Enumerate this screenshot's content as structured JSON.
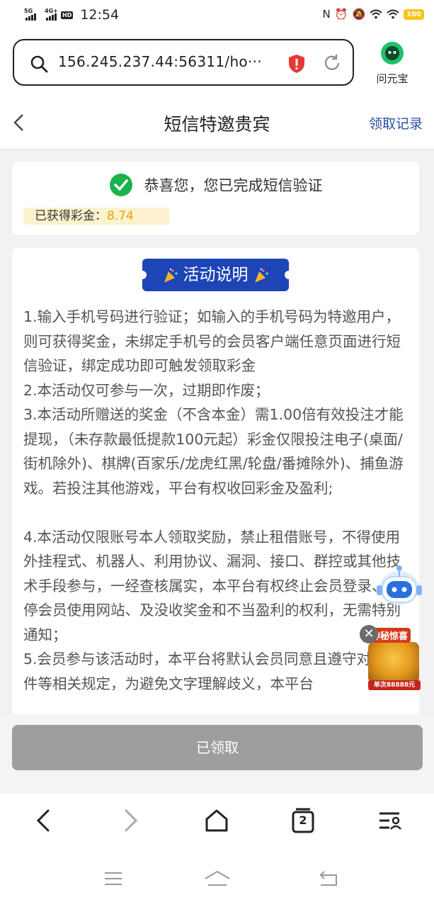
{
  "status_bar": {
    "network_1": "5G",
    "network_2": "4G+",
    "hd_badge": "HD",
    "time": "12:54",
    "battery": "100"
  },
  "browser": {
    "url": "156.245.237.44:56311/ho···",
    "assistant_label": "问元宝"
  },
  "header": {
    "title": "短信特邀贵宾",
    "records_link": "领取记录"
  },
  "verification": {
    "message": "恭喜您，您已完成短信验证",
    "bonus_label": "已获得彩金：",
    "bonus_value": "8.74"
  },
  "activity": {
    "banner_title": "活动说明",
    "rules": [
      "1.输入手机号码进行验证；如输入的手机号码为特邀用户，则可获得奖金，未绑定手机号的会员客户端任意页面进行短信验证，绑定成功即可触发领取彩金",
      "2.本活动仅可参与一次，过期即作废；",
      "3.本活动所赠送的奖金（不含本金）需1.00倍有效投注才能提现，（未存款最低提款100元起）彩金仅限投注电子(桌面/街机除外)、棋牌(百家乐/龙虎红黑/轮盘/番摊除外)、捕鱼游戏。若投注其他游戏，平台有权收回彩金及盈利;",
      "",
      "4.本活动仅限账号本人领取奖励，禁止租借账号，不得使用外挂程式、机器人、利用协议、漏洞、接口、群控或其他技术手段参与，一经查核属实，本平台有权终止会员登录、暂停会员使用网站、及没收奖金和不当盈利的权利，无需特别通知；",
      "5.会员参与该活动时，本平台将默认会员同意且遵守对应条件等相关规定，为避免文字理解歧义，本平台"
    ]
  },
  "promo_widget": {
    "tag": "神秘惊喜",
    "prize": "单次88888元"
  },
  "claim_button": "已领取",
  "bottom_nav": {
    "tab_count": "2"
  }
}
